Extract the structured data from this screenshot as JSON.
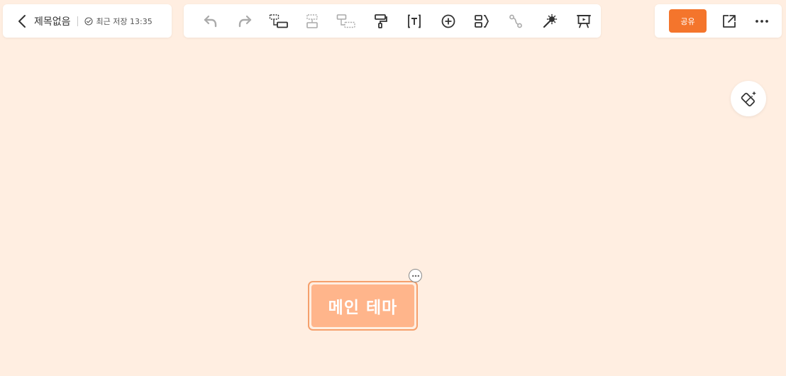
{
  "header": {
    "doc_title": "제목없음",
    "save_status": "최근 저장 13:35"
  },
  "toolbar": {
    "items": [
      {
        "icon": "undo-icon",
        "enabled": false
      },
      {
        "icon": "redo-icon",
        "enabled": false
      },
      {
        "icon": "add-subtopic-icon",
        "enabled": true
      },
      {
        "icon": "add-sibling-topic-icon",
        "enabled": false
      },
      {
        "icon": "add-parent-topic-icon",
        "enabled": false
      },
      {
        "icon": "format-painter-icon",
        "enabled": true
      },
      {
        "icon": "text-icon",
        "enabled": true
      },
      {
        "icon": "insert-icon",
        "enabled": true
      },
      {
        "icon": "summary-icon",
        "enabled": true
      },
      {
        "icon": "relation-line-icon",
        "enabled": false
      },
      {
        "icon": "magic-wand-icon",
        "enabled": true
      },
      {
        "icon": "presentation-icon",
        "enabled": true
      }
    ]
  },
  "right": {
    "share_label": "공유"
  },
  "canvas": {
    "main_topic": "메인 테마"
  },
  "colors": {
    "background": "#FFEEE1",
    "accent": "#F4752C",
    "node_fill": "#FFB58B",
    "node_outline": "#F5A06C",
    "icon_active": "#333333",
    "icon_disabled": "#AAAAAA"
  }
}
